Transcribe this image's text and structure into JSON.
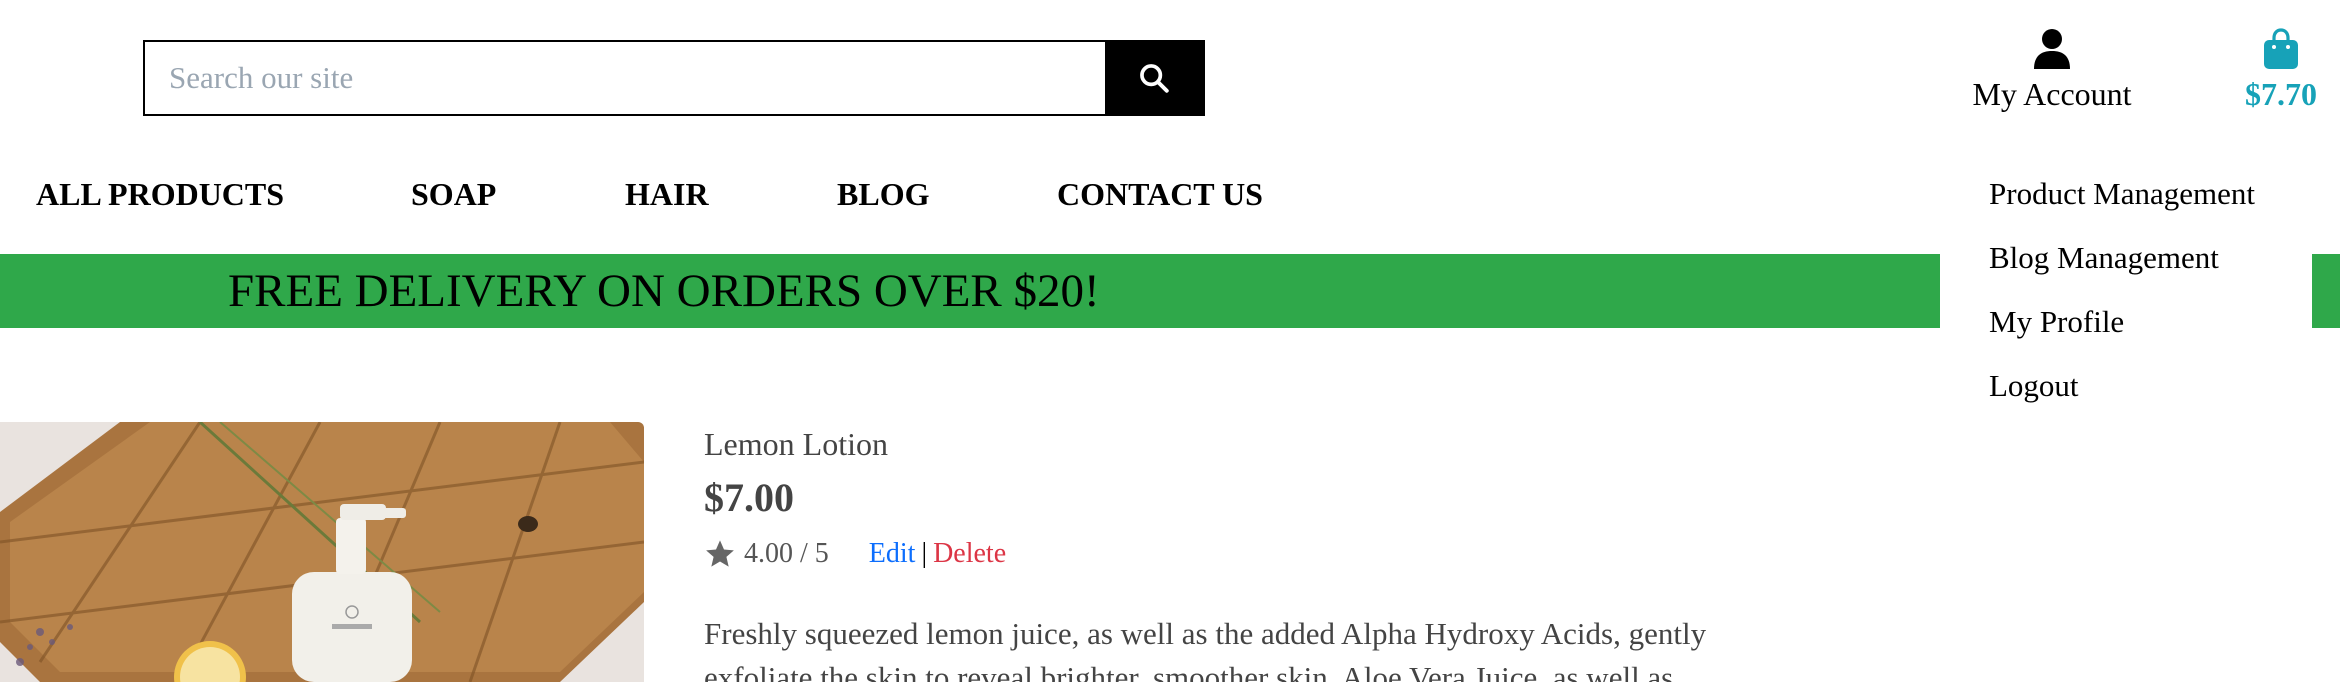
{
  "header": {
    "search": {
      "placeholder": "Search our site",
      "button_icon": "search-icon"
    },
    "account": {
      "label": "My Account",
      "icon": "user-icon"
    },
    "cart": {
      "total": "$7.70",
      "icon": "shopping-bag-icon",
      "color": "#17a2b8"
    }
  },
  "nav": {
    "items": [
      {
        "label": "ALL PRODUCTS"
      },
      {
        "label": "SOAP"
      },
      {
        "label": "HAIR"
      },
      {
        "label": "BLOG"
      },
      {
        "label": "CONTACT US"
      }
    ]
  },
  "account_menu": {
    "items": [
      {
        "label": "Product Management"
      },
      {
        "label": "Blog Management"
      },
      {
        "label": "My Profile"
      },
      {
        "label": "Logout"
      }
    ]
  },
  "banner": {
    "text": "FREE DELIVERY ON ORDERS OVER $20!",
    "color": "#2fa84a"
  },
  "product": {
    "name": "Lemon Lotion",
    "price": "$7.00",
    "rating": "4.00 / 5",
    "rating_icon": "star-icon",
    "edit_label": "Edit",
    "separator": "|",
    "delete_label": "Delete",
    "description": "Freshly squeezed lemon juice, as well as the added Alpha Hydroxy Acids, gently exfoliate the skin to reveal brighter, smoother skin. Aloe Vera Juice, as well as"
  }
}
